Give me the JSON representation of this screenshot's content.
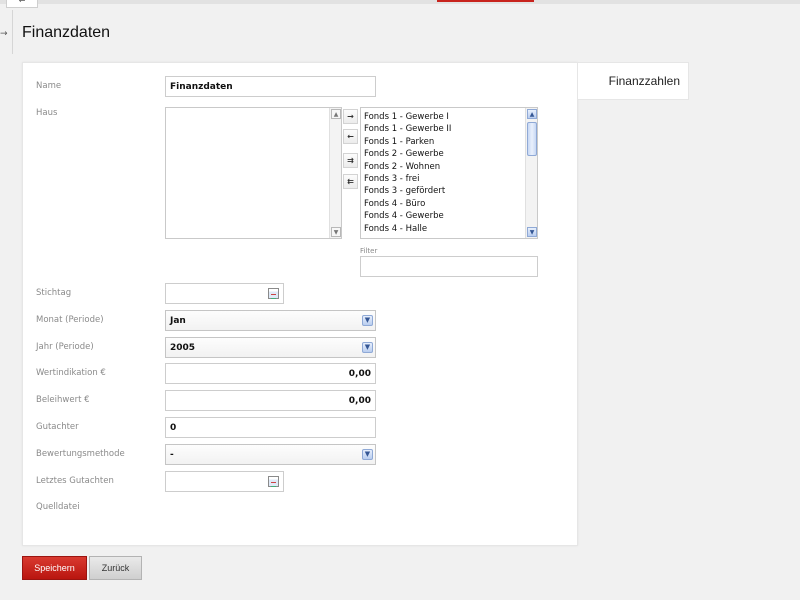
{
  "header": {
    "title": "Finanzdaten",
    "back_arrow": "←",
    "side_arrow": "→"
  },
  "tabs": {
    "finanzzahlen": "Finanzzahlen"
  },
  "form": {
    "name": {
      "label": "Name",
      "value": "Finanzdaten"
    },
    "haus": {
      "label": "Haus",
      "available": [],
      "selected": [
        "Fonds 1 - Gewerbe I",
        "Fonds 1 - Gewerbe II",
        "Fonds 1 - Parken",
        "Fonds 2 - Gewerbe",
        "Fonds 2 - Wohnen",
        "Fonds 3 - frei",
        "Fonds 3 - gefördert",
        "Fonds 4 - Büro",
        "Fonds 4 - Gewerbe",
        "Fonds 4 - Halle"
      ],
      "transfer_buttons": {
        "add": "→",
        "remove": "←",
        "add_all": "⇉",
        "remove_all": "⇇"
      },
      "filter_label": "Filter",
      "filter_value": ""
    },
    "stichtag": {
      "label": "Stichtag",
      "value": ""
    },
    "monat": {
      "label": "Monat (Periode)",
      "value": "Jan"
    },
    "jahr": {
      "label": "Jahr (Periode)",
      "value": "2005"
    },
    "wertindikation": {
      "label": "Wertindikation €",
      "value": "0,00"
    },
    "beleihwert": {
      "label": "Beleihwert €",
      "value": "0,00"
    },
    "gutachter": {
      "label": "Gutachter",
      "value": "0"
    },
    "bewertungsmethode": {
      "label": "Bewertungsmethode",
      "value": "-"
    },
    "letztes_gutachten": {
      "label": "Letztes Gutachten",
      "value": ""
    },
    "quelldatei": {
      "label": "Quelldatei"
    }
  },
  "actions": {
    "save": "Speichern",
    "back": "Zurück"
  },
  "colors": {
    "accent": "#c8231d",
    "panel": "#ffffff",
    "background": "#f1f1f1",
    "dropdown_blue": "#b9cdef"
  },
  "icons": {
    "dropdown": "chevron-down-icon",
    "calendar": "calendar-icon",
    "scroll_up": "arrow-up-icon",
    "scroll_down": "arrow-down-icon"
  }
}
